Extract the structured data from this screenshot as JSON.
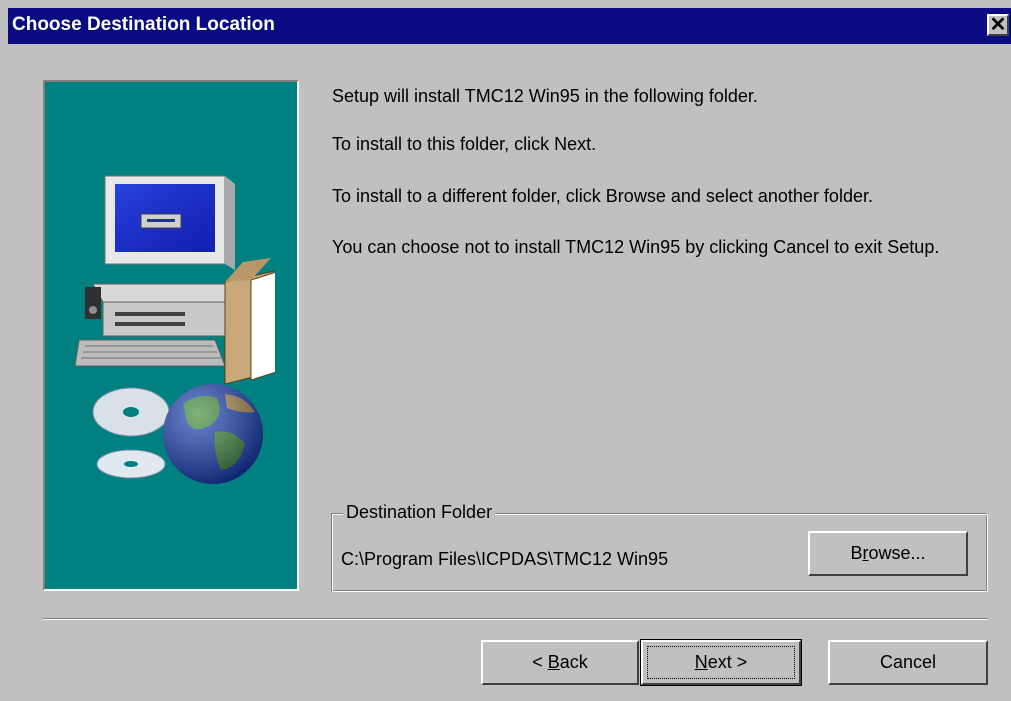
{
  "window": {
    "title": "Choose Destination Location",
    "close_label": "✕"
  },
  "messages": [
    "Setup will install TMC12 Win95 in the following folder.",
    "To install to this folder, click Next.",
    "To install to a different folder, click Browse and select another folder.",
    "You can choose not to install TMC12 Win95 by clicking Cancel to exit Setup."
  ],
  "destination": {
    "legend": "Destination Folder",
    "path": "C:\\Program Files\\ICPDAS\\TMC12 Win95",
    "browse_pre": "B",
    "browse_ul": "r",
    "browse_post": "owse..."
  },
  "buttons": {
    "back_arrow": "<",
    "back_ul": "B",
    "back_post": "ack",
    "next_ul": "N",
    "next_post": "ext",
    "next_arrow": ">",
    "cancel": "Cancel"
  },
  "colors": {
    "titlebar": "#0a0a82",
    "panel": "#008080",
    "face": "#c0c0c0"
  }
}
